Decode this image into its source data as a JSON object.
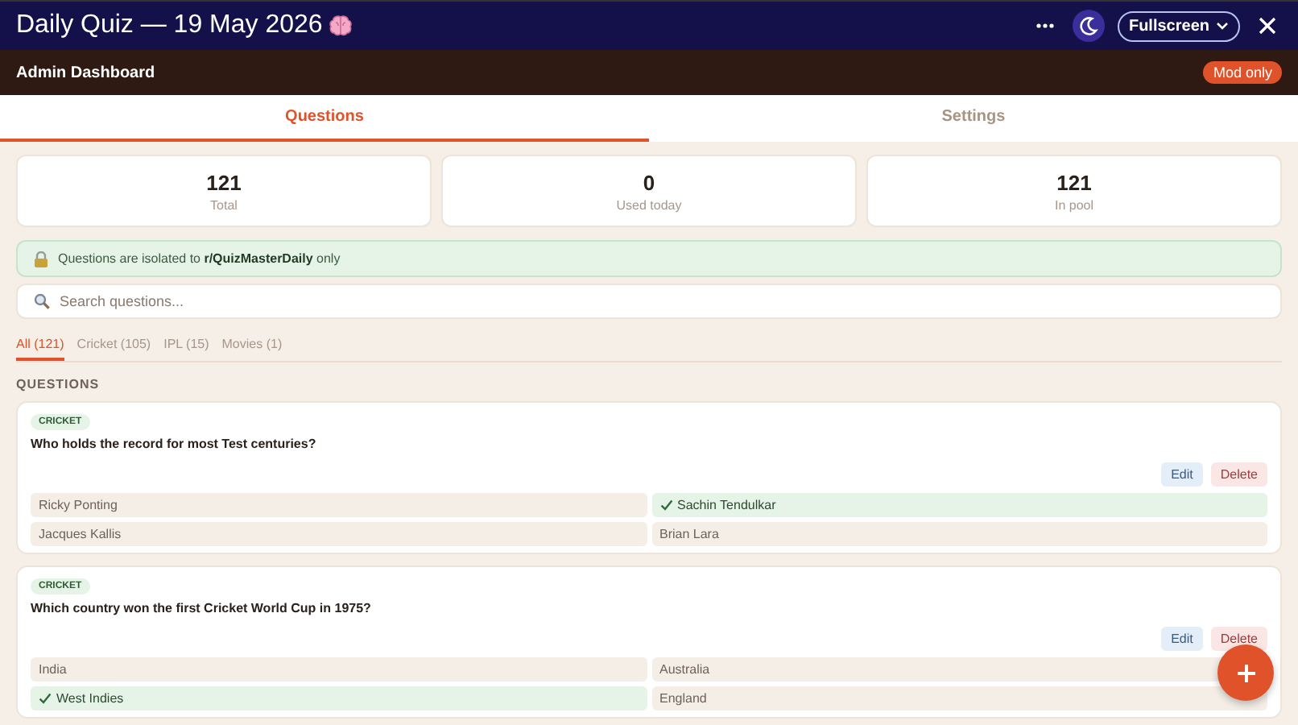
{
  "window": {
    "title": "Daily Quiz — 19 May 2026",
    "fullscreen_label": "Fullscreen"
  },
  "admin_bar": {
    "title": "Admin Dashboard",
    "badge": "Mod only"
  },
  "tabs": [
    {
      "label": "Questions",
      "selected": true
    },
    {
      "label": "Settings",
      "selected": false
    }
  ],
  "stats": [
    {
      "value": "121",
      "label": "Total"
    },
    {
      "value": "0",
      "label": "Used today"
    },
    {
      "value": "121",
      "label": "In pool"
    }
  ],
  "notice": "Questions are isolated to **r/QuizMasterDaily** only",
  "search": {
    "placeholder": "Search questions..."
  },
  "filters": [
    {
      "label": "All (121)",
      "selected": true
    },
    {
      "label": "Cricket (105)",
      "selected": false
    },
    {
      "label": "IPL (15)",
      "selected": false
    },
    {
      "label": "Movies (1)",
      "selected": false
    }
  ],
  "section_title": "QUESTIONS",
  "questions": [
    {
      "category": "CRICKET",
      "text": "Who holds the record for most Test centuries?",
      "edit": "Edit",
      "delete": "Delete",
      "options": [
        {
          "text": "Ricky Ponting",
          "correct": false
        },
        {
          "text": "Sachin Tendulkar",
          "correct": true
        },
        {
          "text": "Jacques Kallis",
          "correct": false
        },
        {
          "text": "Brian Lara",
          "correct": false
        }
      ]
    },
    {
      "category": "CRICKET",
      "text": "Which country won the first Cricket World Cup in 1975?",
      "edit": "Edit",
      "delete": "Delete",
      "options": [
        {
          "text": "India",
          "correct": false
        },
        {
          "text": "Australia",
          "correct": false
        },
        {
          "text": "West Indies",
          "correct": true
        },
        {
          "text": "England",
          "correct": false
        }
      ]
    }
  ]
}
